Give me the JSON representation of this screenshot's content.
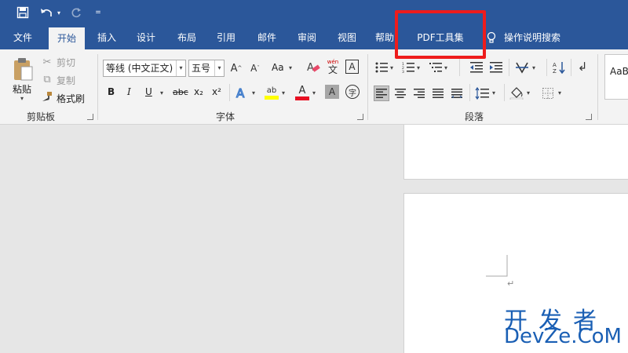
{
  "colors": {
    "ribbon_blue": "#2b579a",
    "highlight": "#ee1c1c",
    "font_color_red": "#e81123",
    "highlight_yellow": "#ffff00",
    "watermark": "#1a5fb4"
  },
  "quick_access": {
    "icons": [
      "save-icon",
      "undo-icon",
      "redo-icon",
      "customize-icon"
    ]
  },
  "tabs": [
    {
      "label": "文件"
    },
    {
      "label": "开始",
      "active": true
    },
    {
      "label": "插入"
    },
    {
      "label": "设计"
    },
    {
      "label": "布局"
    },
    {
      "label": "引用"
    },
    {
      "label": "邮件"
    },
    {
      "label": "审阅"
    },
    {
      "label": "视图"
    },
    {
      "label": "帮助"
    },
    {
      "label": "PDF工具集"
    }
  ],
  "search": {
    "label": "操作说明搜索",
    "icon": "lightbulb-icon"
  },
  "clipboard": {
    "paste": "粘贴",
    "cut": "剪切",
    "copy": "复制",
    "format_painter": "格式刷",
    "group_label": "剪贴板"
  },
  "font": {
    "font_name": "等线 (中文正文)",
    "font_size": "五号",
    "aa_label": "Aa",
    "pinyin_label": "wén",
    "pinyin_char": "文",
    "bold": "B",
    "italic": "I",
    "underline": "U",
    "strike": "abc",
    "subscript": "x₂",
    "superscript": "x²",
    "font_color_letter": "A",
    "char_shade_letter": "A",
    "enclose_char": "字",
    "group_label": "字体"
  },
  "paragraph": {
    "group_label": "段落"
  },
  "styles": {
    "preview": "AaB"
  },
  "document": {
    "paragraph_mark": "↵"
  },
  "watermark": {
    "cn": "开发者",
    "en": "DevZe.CoM"
  }
}
